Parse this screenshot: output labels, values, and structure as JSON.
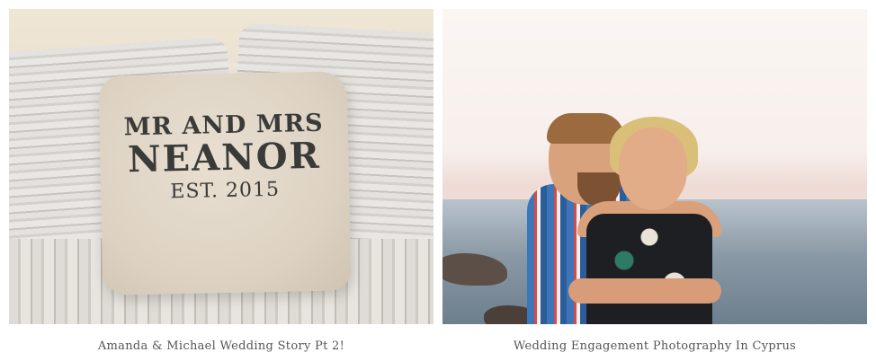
{
  "posts": [
    {
      "title": "Amanda & Michael Wedding Story Pt 2!",
      "pillow_text": {
        "line1": "MR AND MRS",
        "line2": "NEANOR",
        "line3": "EST. 2015"
      }
    },
    {
      "title": "Wedding Engagement Photography In Cyprus"
    }
  ]
}
